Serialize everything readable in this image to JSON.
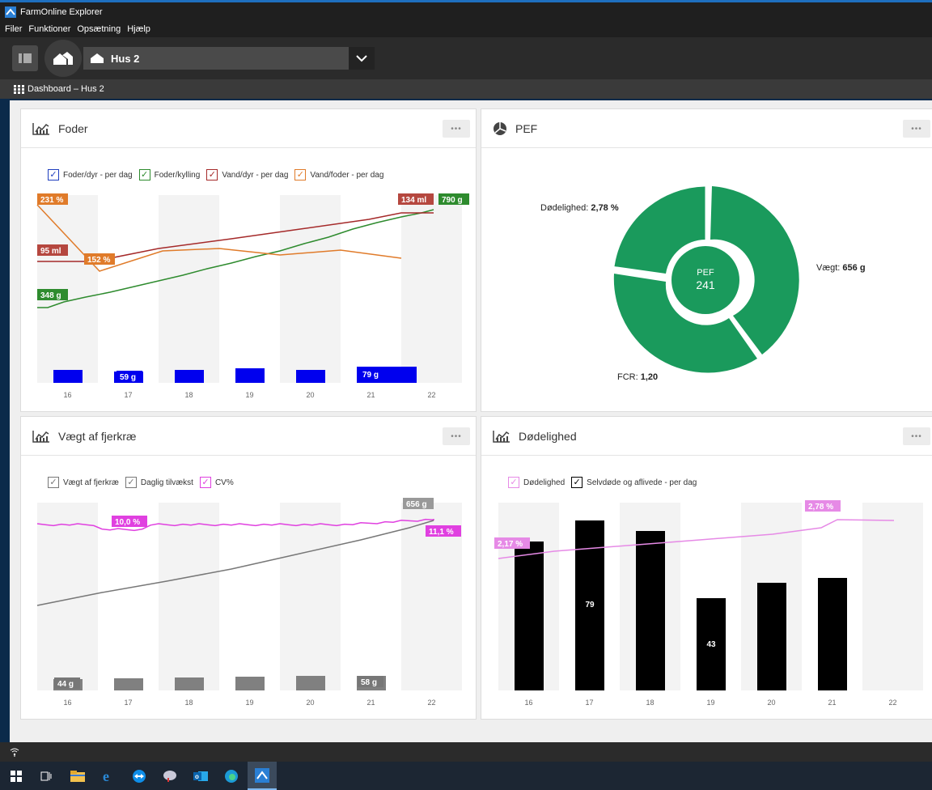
{
  "window": {
    "title": "FarmOnline Explorer"
  },
  "menu": {
    "items": [
      "Filer",
      "Funktioner",
      "Opsætning",
      "Hjælp"
    ]
  },
  "toolbar": {
    "house_select": "Hus 2"
  },
  "breadcrumb": {
    "text": "Dashboard – Hus 2"
  },
  "colors": {
    "accent_green": "#1a9a5c",
    "dark_bg": "#2b2b2b",
    "blue": "#0000ee",
    "magenta": "#e040e0"
  },
  "cards": {
    "foder": {
      "title": "Foder",
      "more": "•••",
      "legend": [
        {
          "label": "Foder/dyr - per dag",
          "color": "#1f3fbf"
        },
        {
          "label": "Foder/kylling",
          "color": "#2e8b2e"
        },
        {
          "label": "Vand/dyr - per dag",
          "color": "#a52a2a"
        },
        {
          "label": "Vand/foder - per dag",
          "color": "#e07b2a"
        }
      ]
    },
    "pef": {
      "title": "PEF",
      "more": "•••",
      "center_label": "PEF",
      "center_value": "241",
      "labels": [
        {
          "name": "Dødelighed:",
          "value": "2,78 %"
        },
        {
          "name": "Vægt:",
          "value": "656 g"
        },
        {
          "name": "FCR:",
          "value": "1,20"
        }
      ]
    },
    "vaegt": {
      "title": "Vægt af fjerkræ",
      "more": "•••",
      "legend": [
        {
          "label": "Vægt af fjerkræ",
          "color": "#777777"
        },
        {
          "label": "Daglig tilvækst",
          "color": "#777777"
        },
        {
          "label": "CV%",
          "color": "#e040e0"
        }
      ]
    },
    "doedelighed": {
      "title": "Dødelighed",
      "more": "•••",
      "legend": [
        {
          "label": "Dødelighed",
          "color": "#e68ae6"
        },
        {
          "label": "Selvdøde og aflivede - per dag",
          "color": "#000000"
        }
      ]
    }
  },
  "chart_data": [
    {
      "type": "line",
      "title": "Foder",
      "categories": [
        "16",
        "17",
        "18",
        "19",
        "20",
        "21",
        "22"
      ],
      "series": [
        {
          "name": "Foder/dyr - per dag",
          "type": "bar",
          "values": [
            null,
            59,
            null,
            null,
            null,
            79,
            null
          ]
        },
        {
          "name": "Foder/kylling",
          "labels": [
            "348 g",
            "790 g"
          ],
          "values": [
            348,
            790
          ]
        },
        {
          "name": "Vand/dyr - per dag",
          "labels": [
            "95 ml",
            "134 ml"
          ],
          "values": [
            95,
            134
          ]
        },
        {
          "name": "Vand/foder - per dag",
          "labels": [
            "231 %",
            "152 %"
          ],
          "values": [
            231,
            152
          ]
        }
      ],
      "annotations": [
        "231 %",
        "95 ml",
        "152 %",
        "348 g",
        "134 ml",
        "790 g",
        "59 g",
        "79 g"
      ]
    },
    {
      "type": "pie",
      "title": "PEF",
      "slices": [
        {
          "label": "Dødelighed",
          "value": 2.78
        },
        {
          "label": "Vægt",
          "value": 656
        },
        {
          "label": "FCR",
          "value": 1.2
        }
      ],
      "center": {
        "label": "PEF",
        "value": 241
      }
    },
    {
      "type": "line",
      "title": "Vægt af fjerkræ",
      "categories": [
        "16",
        "17",
        "18",
        "19",
        "20",
        "21",
        "22"
      ],
      "series": [
        {
          "name": "Vægt af fjerkræ",
          "labels": [
            "656 g"
          ],
          "values": [
            656
          ]
        },
        {
          "name": "Daglig tilvækst",
          "type": "bar",
          "values": [
            44,
            null,
            null,
            null,
            null,
            58,
            null
          ],
          "labels": [
            "44 g",
            "58 g"
          ]
        },
        {
          "name": "CV%",
          "labels": [
            "10,0 %",
            "11,1 %"
          ],
          "values": [
            10.0,
            11.1
          ]
        }
      ]
    },
    {
      "type": "bar",
      "title": "Dødelighed",
      "categories": [
        "16",
        "17",
        "18",
        "19",
        "20",
        "21",
        "22"
      ],
      "series": [
        {
          "name": "Selvdøde og aflivede - per dag",
          "values": [
            null,
            79,
            null,
            43,
            null,
            null,
            null
          ]
        },
        {
          "name": "Dødelighed",
          "labels": [
            "2,17 %",
            "2,78 %"
          ],
          "values": [
            2.17,
            2.78
          ]
        }
      ]
    }
  ]
}
